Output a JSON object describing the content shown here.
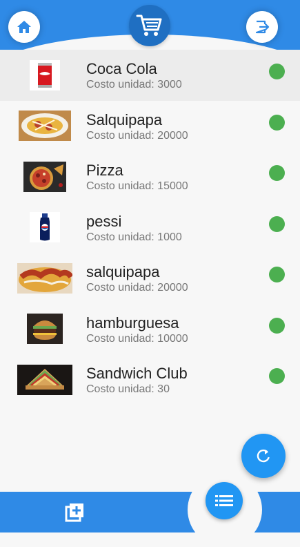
{
  "header": {
    "home_icon": "home-icon",
    "cart_icon": "shopping-cart-icon",
    "logout_icon": "logout-icon"
  },
  "products": [
    {
      "name": "Coca Cola",
      "cost": "Costo unidad: 3000",
      "status": "active",
      "image": "coca-cola-can"
    },
    {
      "name": "Salquipapa",
      "cost": "Costo unidad: 20000",
      "status": "active",
      "image": "salchipapa-plate"
    },
    {
      "name": "Pizza",
      "cost": "Costo unidad: 15000",
      "status": "active",
      "image": "pizza"
    },
    {
      "name": "pessi",
      "cost": "Costo unidad: 1000",
      "status": "active",
      "image": "pepsi-bottle"
    },
    {
      "name": "salquipapa",
      "cost": "Costo unidad: 20000",
      "status": "active",
      "image": "salchipapa"
    },
    {
      "name": "hamburguesa",
      "cost": "Costo unidad: 10000",
      "status": "active",
      "image": "burger"
    },
    {
      "name": "Sandwich Club",
      "cost": "Costo unidad: 30",
      "status": "active",
      "image": "club-sandwich"
    }
  ],
  "colors": {
    "primary": "#2f8ae6",
    "accent": "#2196f3",
    "status_active": "#4caf50"
  },
  "fab": {
    "icon": "refresh-icon"
  },
  "bottom_nav": {
    "add_icon": "add-to-list-icon",
    "list_icon": "list-icon"
  }
}
